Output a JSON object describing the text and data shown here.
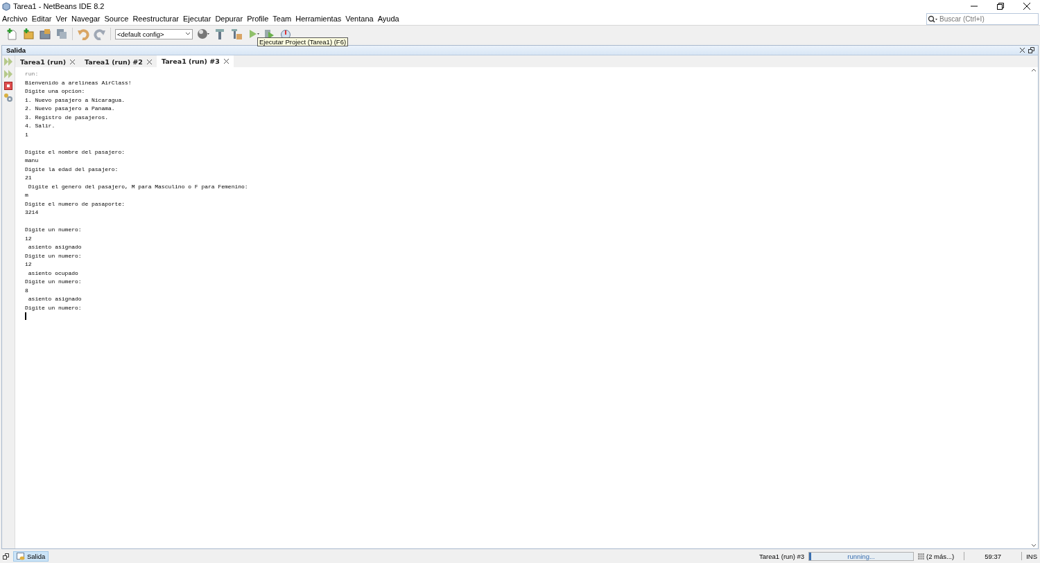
{
  "window": {
    "title": "Tarea1 - NetBeans IDE 8.2"
  },
  "menu": [
    "Archivo",
    "Editar",
    "Ver",
    "Navegar",
    "Source",
    "Reestructurar",
    "Ejecutar",
    "Depurar",
    "Profile",
    "Team",
    "Herramientas",
    "Ventana",
    "Ayuda"
  ],
  "search": {
    "placeholder": "Buscar (Ctrl+I)"
  },
  "toolbar": {
    "config": "<default config>",
    "tooltip": "Ejecutar Project (Tarea1) (F6)"
  },
  "panel": {
    "title": "Salida"
  },
  "tabs": [
    {
      "label": "Tarea1 (run)",
      "selected": false
    },
    {
      "label": "Tarea1 (run) #2",
      "selected": false
    },
    {
      "label": "Tarea1 (run) #3",
      "selected": true
    }
  ],
  "output": {
    "header": "run:",
    "blocks": [
      [
        "Bienvenido a arelineas AirClass!",
        "Digite una opcion:",
        "1. Nuevo pasajero a Nicaragua.",
        "2. Nuevo pasajero a Panama.",
        "3. Registro de pasajeros.",
        "4. Salir.",
        "1"
      ],
      [
        "Digite el nombre del pasajero:",
        "manu",
        "Digite la edad del pasajero:",
        "21",
        " Digite el genero del pasajero, M para Masculino o F para Femenino:",
        "m",
        "Digite el numero de pasaporte:",
        "3214"
      ],
      [
        "Digite un numero:",
        "12",
        " asiento asignado",
        "Digite un numero:",
        "12",
        " asiento ocupado",
        "Digite un numero:",
        "8",
        " asiento asignado",
        "Digite un numero:"
      ]
    ]
  },
  "status_bar": {
    "window_button": "Salida",
    "task": "Tarea1 (run) #3",
    "progress": "running...",
    "level": 0.02,
    "more": "(2 más...)",
    "position": "59:37",
    "mode": "INS"
  }
}
